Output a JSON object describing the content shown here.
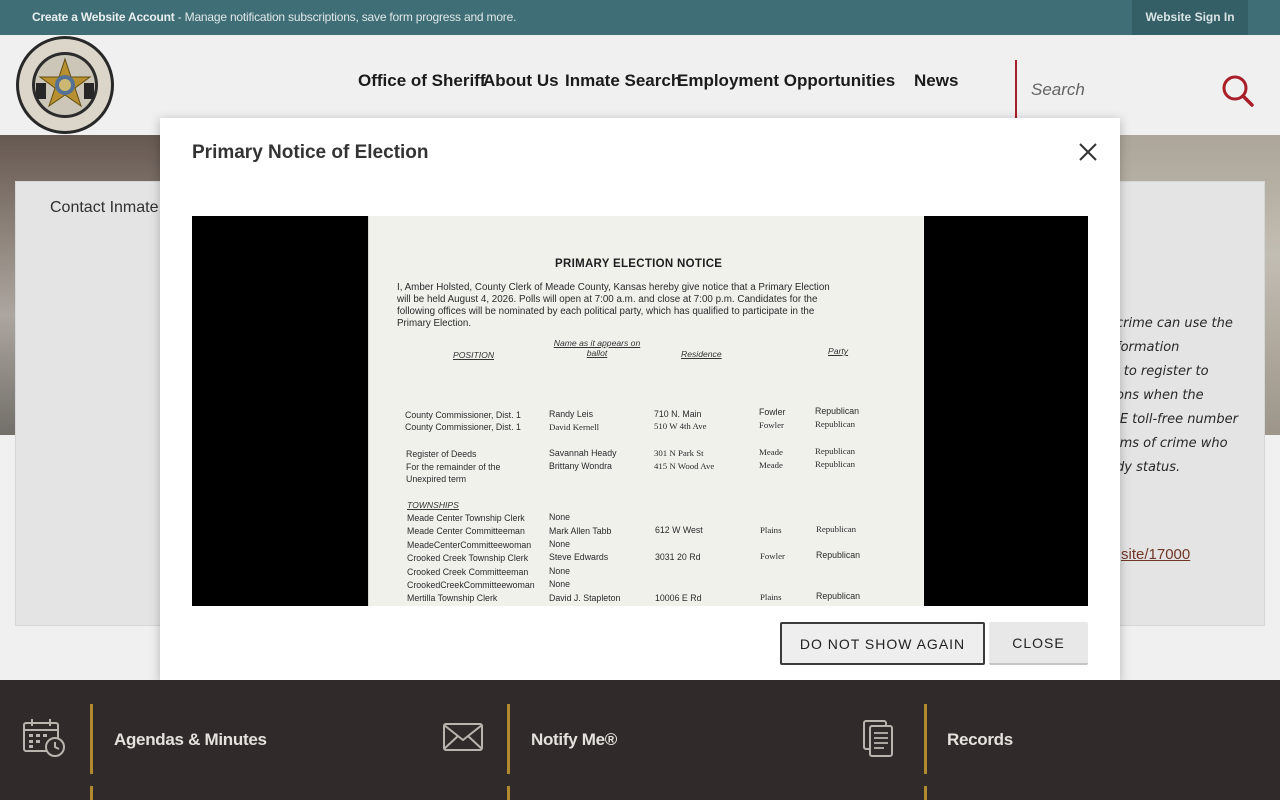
{
  "top_bar": {
    "account_link": "Create a Website Account",
    "account_desc": " - Manage notification subscriptions, save form progress and more.",
    "sign_in": "Website Sign In"
  },
  "header": {
    "logo_text_top": "MEADE COUNTY SHERIFF",
    "logo_text_bottom": "KANSAS",
    "nav": [
      "Office of Sheriff",
      "About Us",
      "Inmate Search",
      "Employment Opportunities",
      "News"
    ],
    "search_placeholder": "Search"
  },
  "background_page": {
    "panel_title": "Contact Inmate",
    "panel_text_lines": [
      "crime can use the",
      "formation",
      "l to register to",
      "ons when the",
      "IE toll-free number",
      "ims of crime who",
      "dy status."
    ],
    "panel_link": "site/17000"
  },
  "modal": {
    "title": "Primary Notice of Election",
    "buttons": {
      "dont_show": "DO NOT SHOW AGAIN",
      "close": "CLOSE"
    },
    "document": {
      "heading": "PRIMARY ELECTION NOTICE",
      "paragraph_lines": [
        "I, Amber Holsted, County Clerk of Meade County, Kansas hereby give notice that a Primary Election",
        "will be held August 4, 2026.  Polls will open at 7:00 a.m. and close at 7:00 p.m.  Candidates for the",
        "following offices will be nominated by each political party, which has qualified to participate in the",
        "Primary Election."
      ],
      "columns": [
        "POSITION",
        "Name as it appears on ballot",
        "Residence",
        "Party"
      ],
      "rows": [
        {
          "position": "County Commissioner, Dist. 1",
          "name": "Randy Leis",
          "address": "710 N. Main",
          "city": "Fowler",
          "party": "Republican"
        },
        {
          "position": "County Commissioner, Dist. 1",
          "name": "David Kernell",
          "address": "510 W 4th Ave",
          "city": "Fowler",
          "party": "Republican"
        },
        {
          "position": "Register of Deeds",
          "name": "Savannah Heady",
          "address": "301 N Park St",
          "city": "Meade",
          "party": "Republican"
        },
        {
          "position": "For the remainder of the",
          "name": "Brittany Wondra",
          "address": "415 N Wood Ave",
          "city": "Meade",
          "party": "Republican"
        },
        {
          "position": "Unexpired term",
          "name": "",
          "address": "",
          "city": "",
          "party": ""
        }
      ],
      "townships_label": "TOWNSHIPS",
      "township_rows": [
        {
          "position": "Meade Center Township Clerk",
          "name": "None",
          "address": "",
          "city": "",
          "party": ""
        },
        {
          "position": "Meade Center Committeeman",
          "name": "Mark Allen Tabb",
          "address": "612 W West",
          "city": "Plains",
          "party": "Republican"
        },
        {
          "position": "MeadeCenterCommitteewoman",
          "name": "None",
          "address": "",
          "city": "",
          "party": ""
        },
        {
          "position": "Crooked Creek Township Clerk",
          "name": "Steve Edwards",
          "address": "3031 20 Rd",
          "city": "Fowler",
          "party": "Republican"
        },
        {
          "position": "Crooked Creek Committeeman",
          "name": "None",
          "address": "",
          "city": "",
          "party": ""
        },
        {
          "position": "CrookedCreekCommitteewoman",
          "name": "None",
          "address": "",
          "city": "",
          "party": ""
        },
        {
          "position": "Mertilla Township Clerk",
          "name": "David J. Stapleton",
          "address": "10006 E Rd",
          "city": "Plains",
          "party": "Republican"
        }
      ]
    }
  },
  "footer": {
    "quick_links": [
      {
        "label": "Agendas & Minutes",
        "icon": "calendar-clock-icon"
      },
      {
        "label": "Notify Me®",
        "icon": "envelope-icon"
      },
      {
        "label": "Records",
        "icon": "documents-icon"
      }
    ],
    "accent_color": "#b18a2e"
  },
  "colors": {
    "top_bar": "#3f6e76",
    "search_accent": "#b3202c",
    "footer": "#302b2a"
  }
}
